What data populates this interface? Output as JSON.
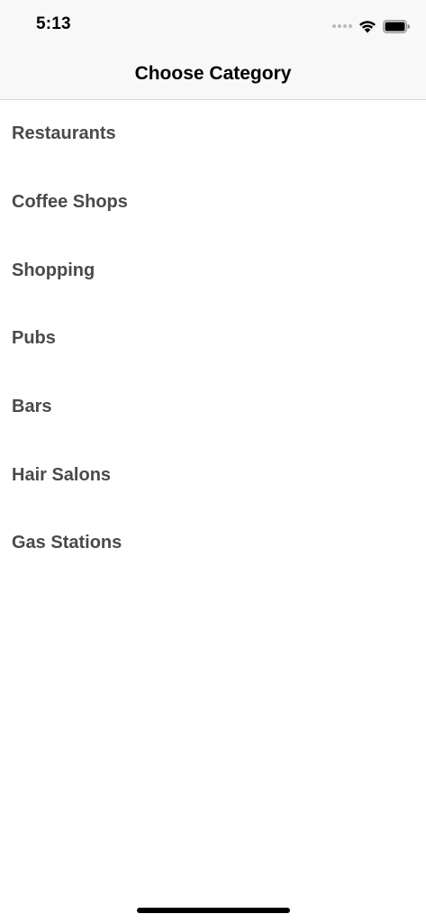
{
  "status_bar": {
    "time": "5:13"
  },
  "nav": {
    "title": "Choose Category"
  },
  "categories": [
    {
      "label": "Restaurants"
    },
    {
      "label": "Coffee Shops"
    },
    {
      "label": "Shopping"
    },
    {
      "label": "Pubs"
    },
    {
      "label": "Bars"
    },
    {
      "label": "Hair Salons"
    },
    {
      "label": "Gas Stations"
    }
  ],
  "colors": {
    "bar_background": "#f8f8f8",
    "item_text": "#4a4a4a",
    "title_text": "#000000",
    "divider": "#d6d6d6"
  },
  "icons": [
    "signal-dots-icon",
    "wifi-icon",
    "battery-icon"
  ]
}
